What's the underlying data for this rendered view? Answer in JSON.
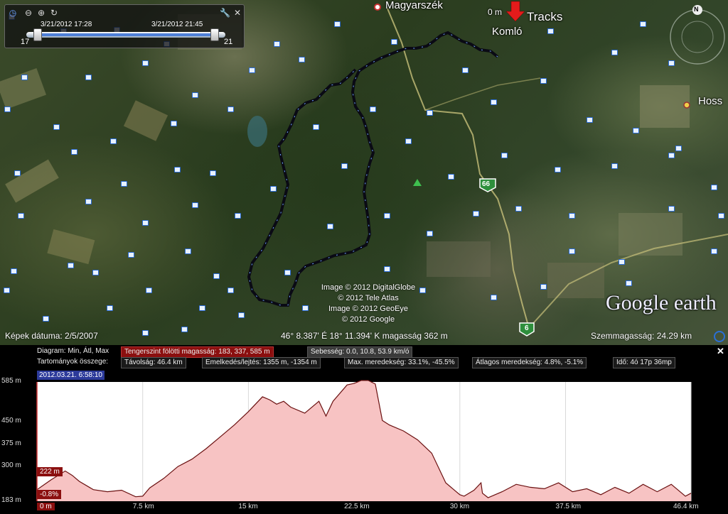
{
  "timeline": {
    "start_label": "3/21/2012  17:28",
    "end_label": "3/21/2012  21:45",
    "min_label": "17",
    "max_label": "21",
    "range": [
      0.05,
      0.96
    ]
  },
  "map": {
    "places": {
      "magyarszek": "Magyarszék",
      "komlo": "Komló",
      "hoss": "Hoss"
    },
    "tracks_label": "Tracks",
    "scale_label": "0 m",
    "compass_label": "N",
    "road_60": "66",
    "road_6": "6",
    "attribution": [
      "Image © 2012 DigitalGlobe",
      "© 2012 Tele Atlas",
      "Image © 2012 GeoEye",
      "© 2012 Google"
    ],
    "logo": "Google earth"
  },
  "status": {
    "imagery_date": "Képek dátuma: 2/5/2007",
    "coords": "46° 8.387' É   18° 11.394' K  magasság   362 m",
    "eye_alt": "Szemmagasság:   24.29 km"
  },
  "profile": {
    "diagram_label": "Diagram: Min, Átl, Max",
    "elevation_box": "Tengerszint fölötti magasság: 183, 337, 585 m",
    "speed_box": "Sebesség: 0.0, 10.8, 53.9 km/ó",
    "ranges_label": "Tartományok összege:",
    "distance_box": "Távolság: 46.4 km",
    "gain_box": "Emelkedés/lejtés: 1355 m, -1354 m",
    "max_slope_box": "Max. meredekség: 33.1%, -45.5%",
    "avg_slope_box": "Átlagos meredekség: 4.8%, -5.1%",
    "time_box": "Idő: 4ó 17p 36mp",
    "cursor_time": "2012.03.21. 6:58:10",
    "cursor_elev": "222 m",
    "cursor_slope": "-0.8%",
    "close": "✕"
  },
  "chart_data": {
    "type": "area",
    "x_unit": "km",
    "y_unit": "m",
    "xlim": [
      0,
      46.4
    ],
    "ylim": [
      183,
      585
    ],
    "yticks": [
      "585 m",
      "450 m",
      "375 m",
      "300 m",
      "183 m"
    ],
    "xticks": [
      "0 m",
      "7.5 km",
      "15 km",
      "22.5 km",
      "30 km",
      "37.5 km",
      "46.4 km"
    ],
    "x": [
      0,
      1,
      2,
      2.5,
      3,
      4,
      5,
      6,
      7,
      7.5,
      8,
      9,
      10,
      11,
      12,
      13,
      14,
      15,
      16,
      16.5,
      17,
      17.5,
      18,
      19,
      20,
      20.5,
      21,
      22,
      22.5,
      23,
      23.5,
      24,
      24.5,
      25,
      26,
      27,
      28,
      29,
      30,
      30.3,
      31,
      31.5,
      31.6,
      32,
      33,
      34,
      35,
      36,
      37,
      38,
      39,
      40,
      41,
      42,
      43,
      44,
      45,
      46,
      46.4
    ],
    "y": [
      222,
      255,
      285,
      270,
      250,
      222,
      215,
      220,
      198,
      200,
      228,
      260,
      300,
      325,
      360,
      400,
      440,
      485,
      535,
      525,
      510,
      520,
      500,
      480,
      520,
      470,
      520,
      575,
      580,
      590,
      590,
      578,
      455,
      440,
      420,
      390,
      345,
      245,
      205,
      200,
      220,
      245,
      210,
      195,
      215,
      240,
      230,
      225,
      245,
      215,
      225,
      205,
      230,
      210,
      240,
      215,
      240,
      200,
      210
    ]
  }
}
